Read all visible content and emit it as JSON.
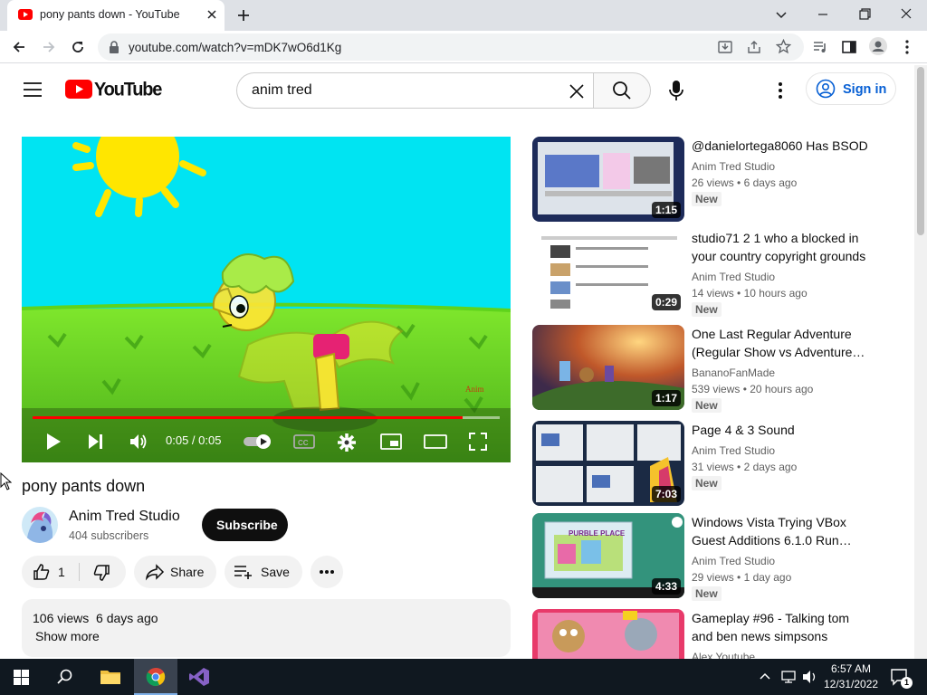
{
  "browser": {
    "tab_title": "pony pants down - YouTube",
    "url": "youtube.com/watch?v=mDK7wO6d1Kg"
  },
  "header": {
    "logo_text": "YouTube",
    "search_value": "anim tred",
    "sign_in": "Sign in"
  },
  "player": {
    "time": "0:05 / 0:05",
    "progress": 0.92,
    "signature": "Anim"
  },
  "video": {
    "title": "pony pants down",
    "channel": "Anim Tred Studio",
    "subscribers": "404 subscribers",
    "subscribe_label": "Subscribe",
    "likes": "1",
    "share_label": "Share",
    "save_label": "Save",
    "views_date": "106 views  6 days ago",
    "show_more": "Show more"
  },
  "recommendations": [
    {
      "title_lines": [
        "@danielortega8060 Has BSOD"
      ],
      "channel": "Anim Tred Studio",
      "views": "26 views",
      "age": "6 days ago",
      "badge": "New",
      "duration": "1:15"
    },
    {
      "title_lines": [
        "studio71 2 1 who a blocked in",
        "your country copyright grounds"
      ],
      "channel": "Anim Tred Studio",
      "views": "14 views",
      "age": "10 hours ago",
      "badge": "New",
      "duration": "0:29"
    },
    {
      "title_lines": [
        "One Last Regular Adventure",
        "(Regular Show vs Adventure…"
      ],
      "channel": "BananoFanMade",
      "views": "539 views",
      "age": "20 hours ago",
      "badge": "New",
      "duration": "1:17"
    },
    {
      "title_lines": [
        "Page 4 & 3 Sound"
      ],
      "channel": "Anim Tred Studio",
      "views": "31 views",
      "age": "2 days ago",
      "badge": "New",
      "duration": "7:03"
    },
    {
      "title_lines": [
        "Windows Vista Trying VBox",
        "Guest Additions 6.1.0 Run…"
      ],
      "channel": "Anim Tred Studio",
      "views": "29 views",
      "age": "1 day ago",
      "badge": "New",
      "duration": "4:33",
      "thumb_caption": "PURBLE PLACE"
    },
    {
      "title_lines": [
        "Gameplay #96 - Talking tom",
        "and ben news simpsons"
      ],
      "channel": "Alex Youtube",
      "views": "",
      "age": "",
      "badge": "",
      "duration": ""
    }
  ],
  "taskbar": {
    "time": "6:57 AM",
    "date": "12/31/2022",
    "notification_count": "1"
  },
  "colors": {
    "youtube_red": "#ff0000",
    "link_blue": "#065fd4",
    "chrome_frame": "#dee1e6",
    "taskbar": "#101820"
  }
}
